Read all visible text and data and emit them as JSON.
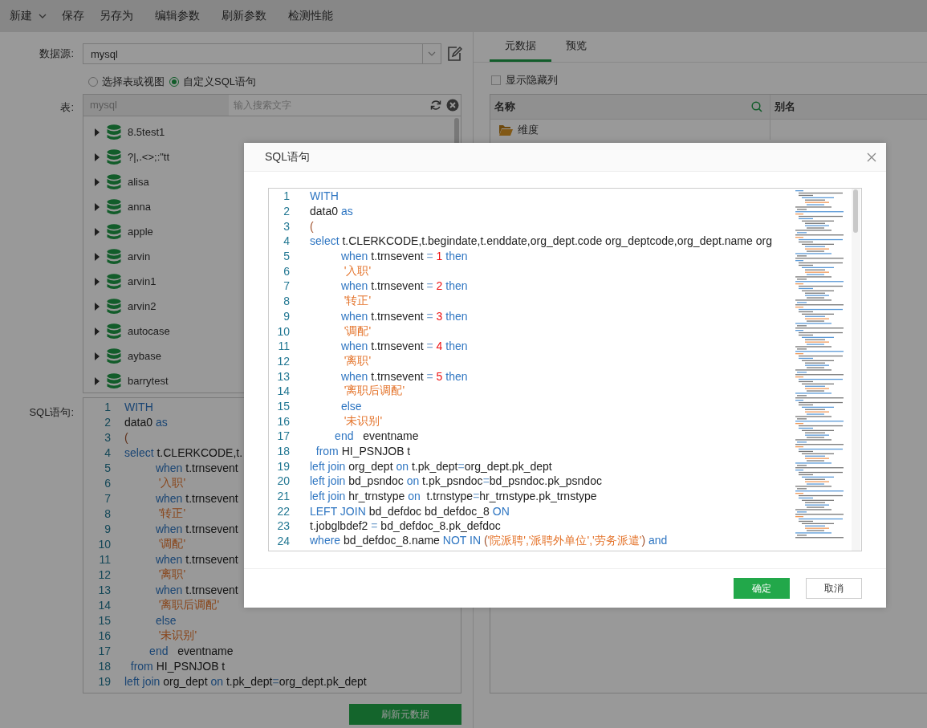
{
  "toolbar": {
    "items": [
      {
        "label": "新建",
        "kind": "dropdown"
      },
      {
        "label": "保存",
        "kind": "plain"
      },
      {
        "label": "另存为",
        "kind": "plain"
      },
      {
        "label": "编辑参数",
        "kind": "plain"
      },
      {
        "label": "刷新参数",
        "kind": "plain"
      },
      {
        "label": "检测性能",
        "kind": "plain"
      }
    ]
  },
  "left_panel": {
    "datasource": {
      "label": "数据源:",
      "value": "mysql"
    },
    "source_mode": [
      {
        "label": "选择表或视图",
        "selected": false
      },
      {
        "label": "自定义SQL语句",
        "selected": true
      }
    ],
    "table": {
      "label": "表:",
      "connection": "mysql",
      "search_placeholder": "输入搜索文字",
      "items": [
        {
          "name": "8.5test1",
          "expanded": false
        },
        {
          "name": "?|,.<>;:\"tt",
          "expanded": false
        },
        {
          "name": "alisa",
          "expanded": false
        },
        {
          "name": "anna",
          "expanded": false
        },
        {
          "name": "apple",
          "expanded": false
        },
        {
          "name": "arvin",
          "expanded": false
        },
        {
          "name": "arvin1",
          "expanded": false
        },
        {
          "name": "arvin2",
          "expanded": false
        },
        {
          "name": "autocase",
          "expanded": false
        },
        {
          "name": "aybase",
          "expanded": false
        },
        {
          "name": "barrytest",
          "expanded": false
        }
      ]
    },
    "sql": {
      "label": "SQL语句:",
      "lines": [
        {
          "n": "1",
          "tokens": [
            {
              "kind": "kw",
              "text": "WITH"
            }
          ]
        },
        {
          "n": "2",
          "tokens": [
            {
              "kind": "plain",
              "text": "data0 "
            },
            {
              "kind": "kw",
              "text": "as"
            }
          ]
        },
        {
          "n": "3",
          "tokens": [
            {
              "kind": "paren",
              "text": "("
            }
          ]
        },
        {
          "n": "4",
          "tokens": [
            {
              "kind": "kw",
              "text": "select"
            },
            {
              "kind": "plain",
              "text": " t.CLERKCODE,t."
            }
          ]
        },
        {
          "n": "5",
          "tokens": [
            {
              "kind": "kw",
              "text": "          when"
            },
            {
              "kind": "plain",
              "text": " t.trnsevent"
            }
          ]
        },
        {
          "n": "6",
          "tokens": [
            {
              "kind": "str",
              "text": "           '入职'"
            }
          ]
        },
        {
          "n": "7",
          "tokens": [
            {
              "kind": "kw",
              "text": "          when"
            },
            {
              "kind": "plain",
              "text": " t.trnsevent"
            }
          ]
        },
        {
          "n": "8",
          "tokens": [
            {
              "kind": "str",
              "text": "           '转正'"
            }
          ]
        },
        {
          "n": "9",
          "tokens": [
            {
              "kind": "kw",
              "text": "          when"
            },
            {
              "kind": "plain",
              "text": " t.trnsevent"
            }
          ]
        },
        {
          "n": "10",
          "tokens": [
            {
              "kind": "str",
              "text": "           '调配'"
            }
          ]
        },
        {
          "n": "11",
          "tokens": [
            {
              "kind": "kw",
              "text": "          when"
            },
            {
              "kind": "plain",
              "text": " t.trnsevent"
            }
          ]
        },
        {
          "n": "12",
          "tokens": [
            {
              "kind": "str",
              "text": "           '离职'"
            }
          ]
        },
        {
          "n": "13",
          "tokens": [
            {
              "kind": "kw",
              "text": "          when"
            },
            {
              "kind": "plain",
              "text": " t.trnsevent"
            }
          ]
        },
        {
          "n": "14",
          "tokens": [
            {
              "kind": "str",
              "text": "           '离职后调配'"
            }
          ]
        },
        {
          "n": "15",
          "tokens": [
            {
              "kind": "kw",
              "text": "          else"
            }
          ]
        },
        {
          "n": "16",
          "tokens": [
            {
              "kind": "str",
              "text": "           '未识别'"
            }
          ]
        },
        {
          "n": "17",
          "tokens": [
            {
              "kind": "kw",
              "text": "        end"
            },
            {
              "kind": "plain",
              "text": "   eventname"
            }
          ]
        },
        {
          "n": "18",
          "tokens": [
            {
              "kind": "kw",
              "text": "  from"
            },
            {
              "kind": "plain",
              "text": " HI_PSNJOB t"
            }
          ]
        },
        {
          "n": "19",
          "tokens": [
            {
              "kind": "kw",
              "text": "left join"
            },
            {
              "kind": "plain",
              "text": " org_dept "
            },
            {
              "kind": "kw",
              "text": "on"
            },
            {
              "kind": "plain",
              "text": " t.pk_dept"
            },
            {
              "kind": "op",
              "text": "="
            },
            {
              "kind": "plain",
              "text": "org_dept.pk_dept"
            }
          ]
        }
      ]
    },
    "refresh_button": "刷新元数据"
  },
  "right_panel": {
    "tabs": [
      {
        "label": "元数据",
        "selected": true
      },
      {
        "label": "预览",
        "selected": false
      }
    ],
    "show_hidden_columns": {
      "label": "显示隐藏列",
      "checked": false
    },
    "table": {
      "columns": [
        {
          "label": "名称",
          "searchable": true
        },
        {
          "label": "别名",
          "searchable": false
        }
      ],
      "rows": [
        {
          "name": "维度",
          "kind": "folder"
        }
      ]
    }
  },
  "dialog": {
    "title": "SQL语句",
    "lines": [
      {
        "n": "1",
        "tokens": [
          {
            "kind": "kw",
            "text": "WITH"
          }
        ]
      },
      {
        "n": "2",
        "tokens": [
          {
            "kind": "plain",
            "text": "data0 "
          },
          {
            "kind": "kw",
            "text": "as"
          }
        ]
      },
      {
        "n": "3",
        "tokens": [
          {
            "kind": "paren",
            "text": "("
          }
        ]
      },
      {
        "n": "4",
        "tokens": [
          {
            "kind": "kw",
            "text": "select"
          },
          {
            "kind": "plain",
            "text": " t.CLERKCODE,t.begindate,t.enddate,org_dept.code org_deptcode,org_dept.name org"
          }
        ]
      },
      {
        "n": "5",
        "tokens": [
          {
            "kind": "kw",
            "text": "          when"
          },
          {
            "kind": "plain",
            "text": " t.trnsevent "
          },
          {
            "kind": "op",
            "text": "="
          },
          {
            "kind": "num",
            "text": " 1"
          },
          {
            "kind": "kw",
            "text": " then"
          }
        ]
      },
      {
        "n": "6",
        "tokens": [
          {
            "kind": "str",
            "text": "           '入职'"
          }
        ]
      },
      {
        "n": "7",
        "tokens": [
          {
            "kind": "kw",
            "text": "          when"
          },
          {
            "kind": "plain",
            "text": " t.trnsevent "
          },
          {
            "kind": "op",
            "text": "="
          },
          {
            "kind": "num",
            "text": " 2"
          },
          {
            "kind": "kw",
            "text": " then"
          }
        ]
      },
      {
        "n": "8",
        "tokens": [
          {
            "kind": "str",
            "text": "           '转正'"
          }
        ]
      },
      {
        "n": "9",
        "tokens": [
          {
            "kind": "kw",
            "text": "          when"
          },
          {
            "kind": "plain",
            "text": " t.trnsevent "
          },
          {
            "kind": "op",
            "text": "="
          },
          {
            "kind": "num",
            "text": " 3"
          },
          {
            "kind": "kw",
            "text": " then"
          }
        ]
      },
      {
        "n": "10",
        "tokens": [
          {
            "kind": "str",
            "text": "           '调配'"
          }
        ]
      },
      {
        "n": "11",
        "tokens": [
          {
            "kind": "kw",
            "text": "          when"
          },
          {
            "kind": "plain",
            "text": " t.trnsevent "
          },
          {
            "kind": "op",
            "text": "="
          },
          {
            "kind": "num",
            "text": " 4"
          },
          {
            "kind": "kw",
            "text": " then"
          }
        ]
      },
      {
        "n": "12",
        "tokens": [
          {
            "kind": "str",
            "text": "           '离职'"
          }
        ]
      },
      {
        "n": "13",
        "tokens": [
          {
            "kind": "kw",
            "text": "          when"
          },
          {
            "kind": "plain",
            "text": " t.trnsevent "
          },
          {
            "kind": "op",
            "text": "="
          },
          {
            "kind": "num",
            "text": " 5"
          },
          {
            "kind": "kw",
            "text": " then"
          }
        ]
      },
      {
        "n": "14",
        "tokens": [
          {
            "kind": "str",
            "text": "           '离职后调配'"
          }
        ]
      },
      {
        "n": "15",
        "tokens": [
          {
            "kind": "kw",
            "text": "          else"
          }
        ]
      },
      {
        "n": "16",
        "tokens": [
          {
            "kind": "str",
            "text": "           '未识别'"
          }
        ]
      },
      {
        "n": "17",
        "tokens": [
          {
            "kind": "kw",
            "text": "        end"
          },
          {
            "kind": "plain",
            "text": "   eventname"
          }
        ]
      },
      {
        "n": "18",
        "tokens": [
          {
            "kind": "kw",
            "text": "  from"
          },
          {
            "kind": "plain",
            "text": " HI_PSNJOB t"
          }
        ]
      },
      {
        "n": "19",
        "tokens": [
          {
            "kind": "kw",
            "text": "left join"
          },
          {
            "kind": "plain",
            "text": " org_dept "
          },
          {
            "kind": "kw",
            "text": "on"
          },
          {
            "kind": "plain",
            "text": " t.pk_dept"
          },
          {
            "kind": "op",
            "text": "="
          },
          {
            "kind": "plain",
            "text": "org_dept.pk_dept"
          }
        ]
      },
      {
        "n": "20",
        "tokens": [
          {
            "kind": "kw",
            "text": "left join"
          },
          {
            "kind": "plain",
            "text": " bd_psndoc "
          },
          {
            "kind": "kw",
            "text": "on"
          },
          {
            "kind": "plain",
            "text": " t.pk_psndoc"
          },
          {
            "kind": "op",
            "text": "="
          },
          {
            "kind": "plain",
            "text": "bd_psndoc.pk_psndoc"
          }
        ]
      },
      {
        "n": "21",
        "tokens": [
          {
            "kind": "kw",
            "text": "left join"
          },
          {
            "kind": "plain",
            "text": " hr_trnstype "
          },
          {
            "kind": "kw",
            "text": "on"
          },
          {
            "kind": "plain",
            "text": "  t.trnstype"
          },
          {
            "kind": "op",
            "text": "="
          },
          {
            "kind": "plain",
            "text": "hr_trnstype.pk_trnstype"
          }
        ]
      },
      {
        "n": "22",
        "tokens": [
          {
            "kind": "kw",
            "text": "LEFT JOIN"
          },
          {
            "kind": "plain",
            "text": " bd_defdoc bd_defdoc_8 "
          },
          {
            "kind": "kw",
            "text": "ON"
          }
        ]
      },
      {
        "n": "23",
        "tokens": [
          {
            "kind": "plain",
            "text": "t.jobglbdef2 "
          },
          {
            "kind": "op",
            "text": "="
          },
          {
            "kind": "plain",
            "text": " bd_defdoc_8.pk_defdoc"
          }
        ]
      },
      {
        "n": "24",
        "tokens": [
          {
            "kind": "kw",
            "text": "where"
          },
          {
            "kind": "plain",
            "text": " bd_defdoc_8.name "
          },
          {
            "kind": "kw",
            "text": "NOT IN"
          },
          {
            "kind": "paren",
            "text": " ("
          },
          {
            "kind": "str",
            "text": "'院派聘','派聘外单位','劳务派遣'"
          },
          {
            "kind": "paren",
            "text": ")"
          },
          {
            "kind": "kw",
            "text": " and"
          }
        ]
      }
    ],
    "buttons": [
      {
        "label": "确定",
        "kind": "primary"
      },
      {
        "label": "取消",
        "kind": "default"
      }
    ]
  }
}
